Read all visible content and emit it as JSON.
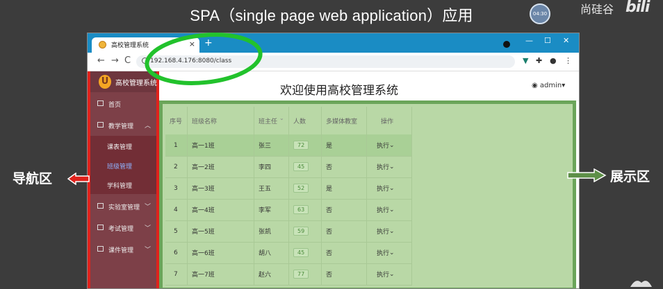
{
  "slide": {
    "title": "SPA（single page web application）应用",
    "timer": "04:30",
    "watermark": "尚硅谷",
    "watermark_logo": "bilibili",
    "left_label": "导航区",
    "right_label": "展示区"
  },
  "browser": {
    "tab_title": "高校管理系统",
    "tab_close": "×",
    "new_tab": "+",
    "url": "192.168.4.176:8080/class",
    "win_min": "—",
    "win_max": "☐",
    "win_close": "✕"
  },
  "app": {
    "brand": "高校管理系统",
    "brand_logo": "U",
    "header_title": "欢迎使用高校管理系统",
    "user": "admin",
    "sidebar": {
      "home": "首页",
      "teaching": "教学管理",
      "sub_schedule": "课表管理",
      "sub_class": "班级管理",
      "sub_subject": "学科管理",
      "lab": "实验室管理",
      "exam": "考试管理",
      "courseware": "课件管理"
    },
    "table": {
      "headers": [
        "序号",
        "班级名称",
        "班主任",
        "人数",
        "多媒体教室",
        "操作"
      ],
      "rows": [
        {
          "no": "1",
          "name": "高一1班",
          "teacher": "张三",
          "count": "72",
          "media": "是",
          "op": "执行"
        },
        {
          "no": "2",
          "name": "高一2班",
          "teacher": "李四",
          "count": "45",
          "media": "否",
          "op": "执行"
        },
        {
          "no": "3",
          "name": "高一3班",
          "teacher": "王五",
          "count": "52",
          "media": "是",
          "op": "执行"
        },
        {
          "no": "4",
          "name": "高一4班",
          "teacher": "李军",
          "count": "63",
          "media": "否",
          "op": "执行"
        },
        {
          "no": "5",
          "name": "高一5班",
          "teacher": "张凯",
          "count": "59",
          "media": "否",
          "op": "执行"
        },
        {
          "no": "6",
          "name": "高一6班",
          "teacher": "胡八",
          "count": "45",
          "media": "否",
          "op": "执行"
        },
        {
          "no": "7",
          "name": "高一7班",
          "teacher": "赵六",
          "count": "77",
          "media": "否",
          "op": "执行"
        }
      ]
    }
  },
  "colors": {
    "sidebar_bg": "#7d4048",
    "highlight_red": "#e0221c",
    "content_green": "#b9d8a6",
    "annotation_green": "#22c22c"
  }
}
